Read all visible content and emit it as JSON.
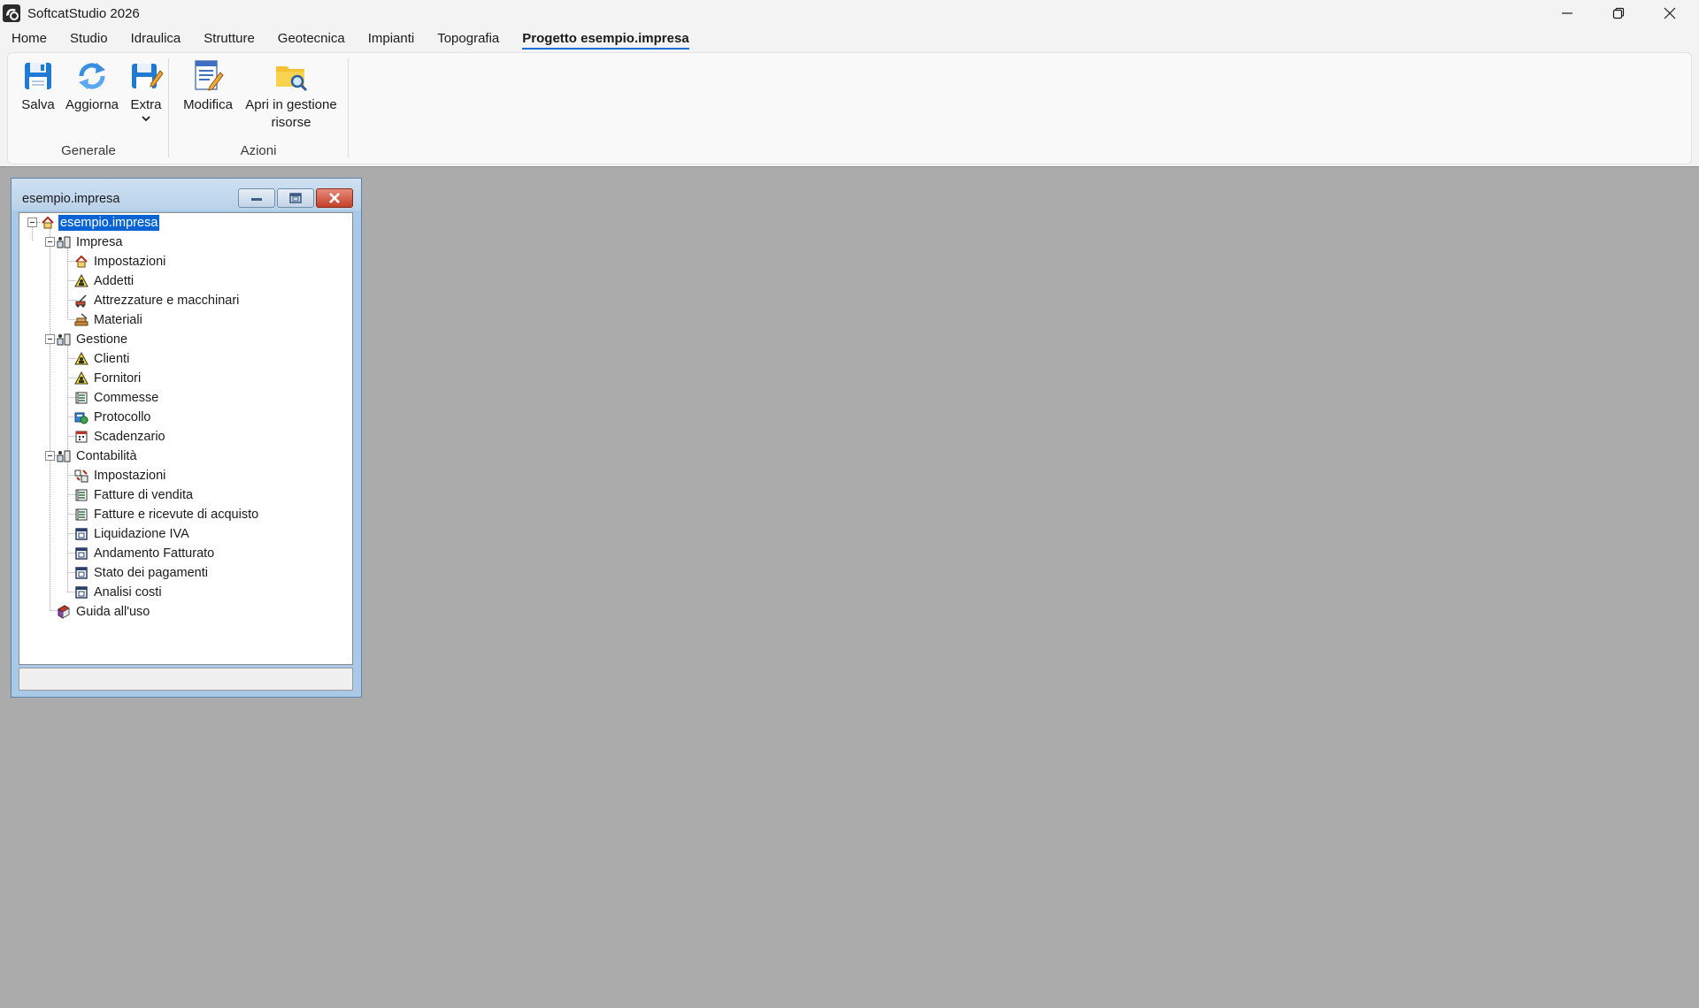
{
  "app": {
    "title": "SoftcatStudio 2026"
  },
  "menu": {
    "tabs": [
      {
        "label": "Home"
      },
      {
        "label": "Studio"
      },
      {
        "label": "Idraulica"
      },
      {
        "label": "Strutture"
      },
      {
        "label": "Geotecnica"
      },
      {
        "label": "Impianti"
      },
      {
        "label": "Topografia"
      },
      {
        "label": "Progetto esempio.impresa",
        "active": true
      }
    ]
  },
  "ribbon": {
    "groups": [
      {
        "label": "Generale",
        "buttons": [
          {
            "label": "Salva",
            "icon": "floppy-disk-icon"
          },
          {
            "label": "Aggiorna",
            "icon": "refresh-icon"
          },
          {
            "label": "Extra",
            "icon": "floppy-edit-icon",
            "dropdown": true
          }
        ]
      },
      {
        "label": "Azioni",
        "buttons": [
          {
            "label": "Modifica",
            "icon": "edit-document-icon"
          },
          {
            "label": "Apri in gestione risorse",
            "line1": "Apri in gestione",
            "line2": "risorse",
            "icon": "folder-search-icon"
          }
        ]
      }
    ]
  },
  "child_window": {
    "title": "esempio.impresa",
    "tree": {
      "root": {
        "label": "esempio.impresa",
        "icon": "house-icon",
        "selected": true
      },
      "nodes": [
        {
          "label": "Impresa",
          "icon": "group-icon",
          "children": [
            {
              "label": "Impostazioni",
              "icon": "house-icon"
            },
            {
              "label": "Addetti",
              "icon": "people-icon"
            },
            {
              "label": "Attrezzature e macchinari",
              "icon": "machinery-icon"
            },
            {
              "label": "Materiali",
              "icon": "materials-icon"
            }
          ]
        },
        {
          "label": "Gestione",
          "icon": "group-icon",
          "children": [
            {
              "label": "Clienti",
              "icon": "people-icon"
            },
            {
              "label": "Fornitori",
              "icon": "people-icon"
            },
            {
              "label": "Commesse",
              "icon": "list-icon"
            },
            {
              "label": "Protocollo",
              "icon": "protocol-icon"
            },
            {
              "label": "Scadenzario",
              "icon": "calendar-icon"
            }
          ]
        },
        {
          "label": "Contabilità",
          "icon": "group-icon",
          "children": [
            {
              "label": "Impostazioni",
              "icon": "settings-icon"
            },
            {
              "label": "Fatture di vendita",
              "icon": "list-icon"
            },
            {
              "label": "Fatture e ricevute di acquisto",
              "icon": "list-icon"
            },
            {
              "label": "Liquidazione IVA",
              "icon": "report-icon"
            },
            {
              "label": "Andamento Fatturato",
              "icon": "report-icon"
            },
            {
              "label": "Stato dei pagamenti",
              "icon": "report-icon"
            },
            {
              "label": "Analisi costi",
              "icon": "report-icon"
            }
          ]
        },
        {
          "label": "Guida all'uso",
          "icon": "book-icon",
          "children": []
        }
      ]
    }
  },
  "colors": {
    "accent": "#1d6fd6",
    "selection": "#0a64d6",
    "mdi_background": "#ababab"
  }
}
